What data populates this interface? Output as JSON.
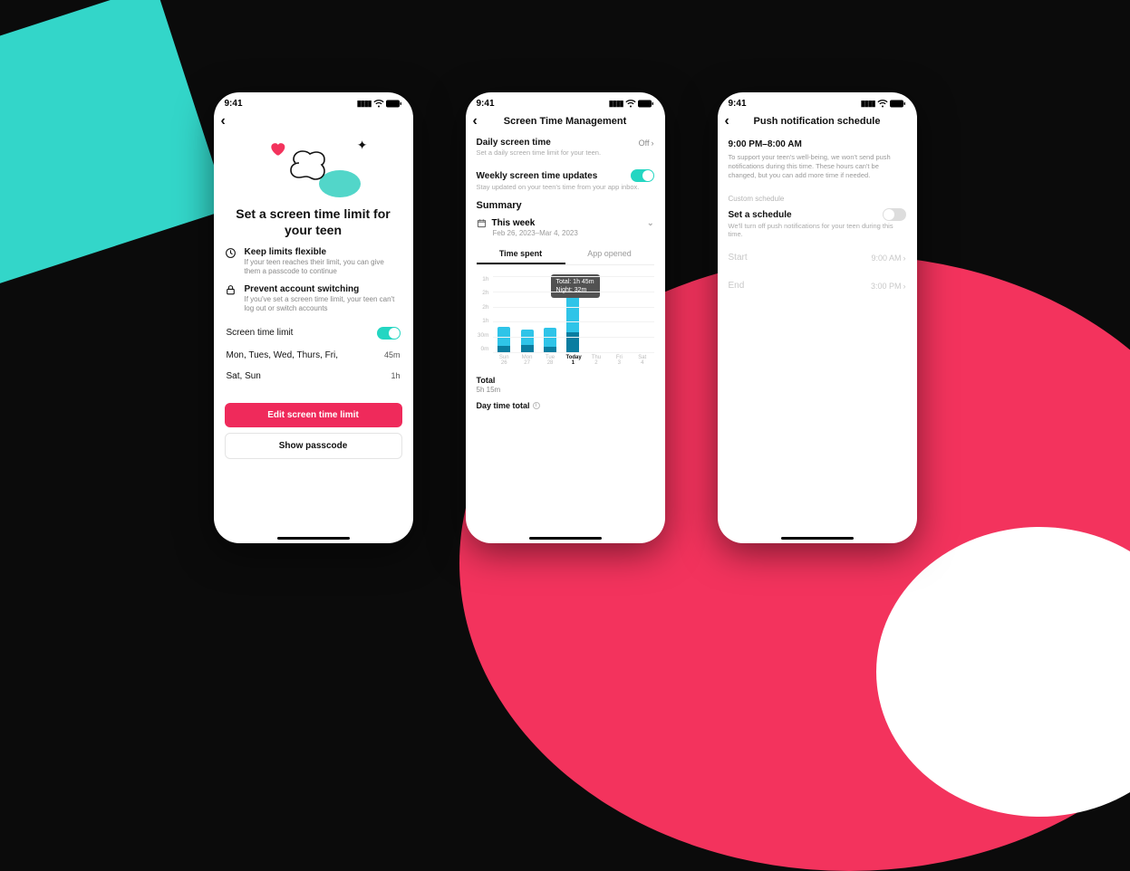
{
  "status_bar": {
    "time": "9:41"
  },
  "screen1": {
    "title": "Set a screen time limit for your teen",
    "features": [
      {
        "title": "Keep limits flexible",
        "desc": "If your teen reaches their limit, you can give them a passcode to continue"
      },
      {
        "title": "Prevent account switching",
        "desc": "If you've set a screen time limit, your teen can't log out or switch accounts"
      }
    ],
    "screen_time_limit": {
      "label": "Screen time limit",
      "on": true
    },
    "schedule": [
      {
        "days": "Mon, Tues, Wed, Thurs, Fri,",
        "value": "45m"
      },
      {
        "days": "Sat, Sun",
        "value": "1h"
      }
    ],
    "buttons": {
      "primary": "Edit screen time limit",
      "secondary": "Show passcode"
    }
  },
  "screen2": {
    "nav_title": "Screen Time Management",
    "daily": {
      "label": "Daily screen time",
      "value": "Off",
      "sub": "Set a daily screen time limit for your teen."
    },
    "weekly": {
      "label": "Weekly screen time updates",
      "sub": "Stay updated on your teen's time from your app inbox.",
      "on": true
    },
    "summary_label": "Summary",
    "week": {
      "label": "This week",
      "range": "Feb 26, 2023–Mar 4, 2023"
    },
    "tabs": {
      "time_spent": "Time spent",
      "app_opened": "App opened"
    },
    "tooltip": {
      "total": "Total: 1h 45m",
      "night": "Night: 32m"
    },
    "total": {
      "label": "Total",
      "value": "5h 15m"
    },
    "day_total_label": "Day time total"
  },
  "screen3": {
    "nav_title": "Push notification schedule",
    "range": "9:00 PM–8:00 AM",
    "desc": "To support your teen's well-being, we won't send push notifications during this time. These hours can't be changed, but you can add more time if needed.",
    "custom_label": "Custom schedule",
    "set_schedule": {
      "label": "Set a schedule",
      "on": false,
      "sub": "We'll turn off push notifications for your teen during this time."
    },
    "start": {
      "label": "Start",
      "value": "9:00 AM"
    },
    "end": {
      "label": "End",
      "value": "3:00 PM"
    }
  },
  "chart_data": {
    "type": "bar",
    "title": "Time spent",
    "ylabel": "",
    "ylim": [
      0,
      120
    ],
    "y_ticks": [
      "1h",
      "2h",
      "2h",
      "1h",
      "30m",
      "0m"
    ],
    "categories": [
      {
        "top": "Sun",
        "bottom": "26"
      },
      {
        "top": "Mon",
        "bottom": "27"
      },
      {
        "top": "Tue",
        "bottom": "28"
      },
      {
        "top": "Today",
        "bottom": "1"
      },
      {
        "top": "Thu",
        "bottom": "2"
      },
      {
        "top": "Fri",
        "bottom": "3"
      },
      {
        "top": "Sat",
        "bottom": "4"
      }
    ],
    "series": [
      {
        "name": "Day",
        "values": [
          30,
          24,
          30,
          73,
          0,
          0,
          0
        ]
      },
      {
        "name": "Night",
        "values": [
          10,
          12,
          8,
          32,
          0,
          0,
          0
        ]
      }
    ],
    "tooltip_index": 3
  }
}
